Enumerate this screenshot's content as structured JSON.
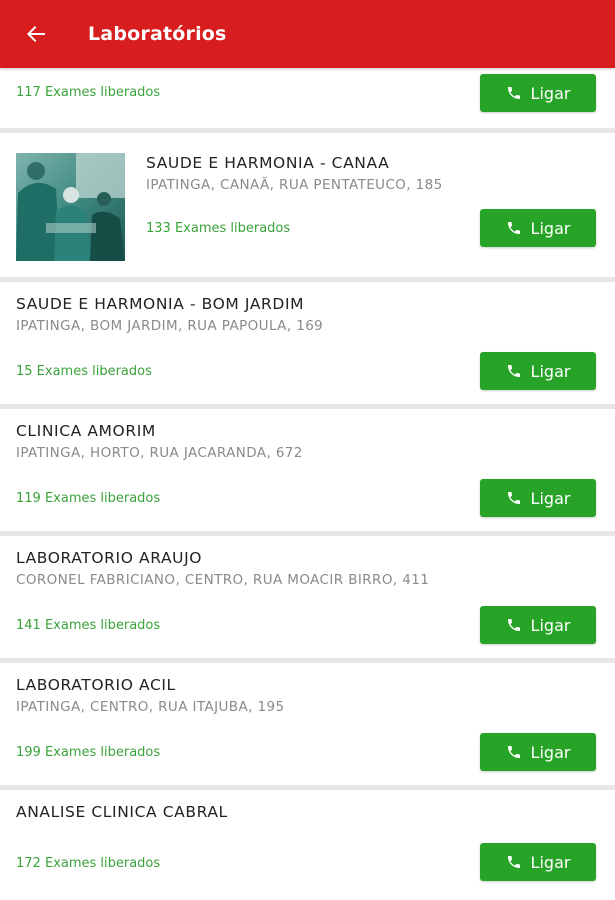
{
  "header": {
    "title": "Laboratórios",
    "back_icon": "arrow-left-icon",
    "color": "#d71d1d"
  },
  "call_label": "Ligar",
  "accent_green": "#27a327",
  "labs": [
    {
      "name": "",
      "address": "",
      "exams": "117 Exames liberados",
      "has_image": false
    },
    {
      "name": "SAUDE E HARMONIA - CANAA",
      "address": "IPATINGA, CANAÃ, RUA PENTATEUCO, 185",
      "exams": "133 Exames liberados",
      "has_image": true
    },
    {
      "name": "SAUDE E HARMONIA - BOM JARDIM",
      "address": "IPATINGA, BOM JARDIM, RUA PAPOULA, 169",
      "exams": "15 Exames liberados",
      "has_image": false
    },
    {
      "name": "CLINICA AMORIM",
      "address": "IPATINGA, HORTO, RUA JACARANDA, 672",
      "exams": "119 Exames liberados",
      "has_image": false
    },
    {
      "name": "LABORATORIO ARAUJO",
      "address": "CORONEL FABRICIANO, CENTRO, RUA MOACIR BIRRO, 411",
      "exams": "141 Exames liberados",
      "has_image": false
    },
    {
      "name": "LABORATORIO ACIL",
      "address": "IPATINGA, CENTRO, RUA ITAJUBA, 195",
      "exams": "199 Exames liberados",
      "has_image": false
    },
    {
      "name": "ANALISE CLINICA CABRAL",
      "address": "",
      "exams": "172 Exames liberados",
      "has_image": false
    }
  ]
}
